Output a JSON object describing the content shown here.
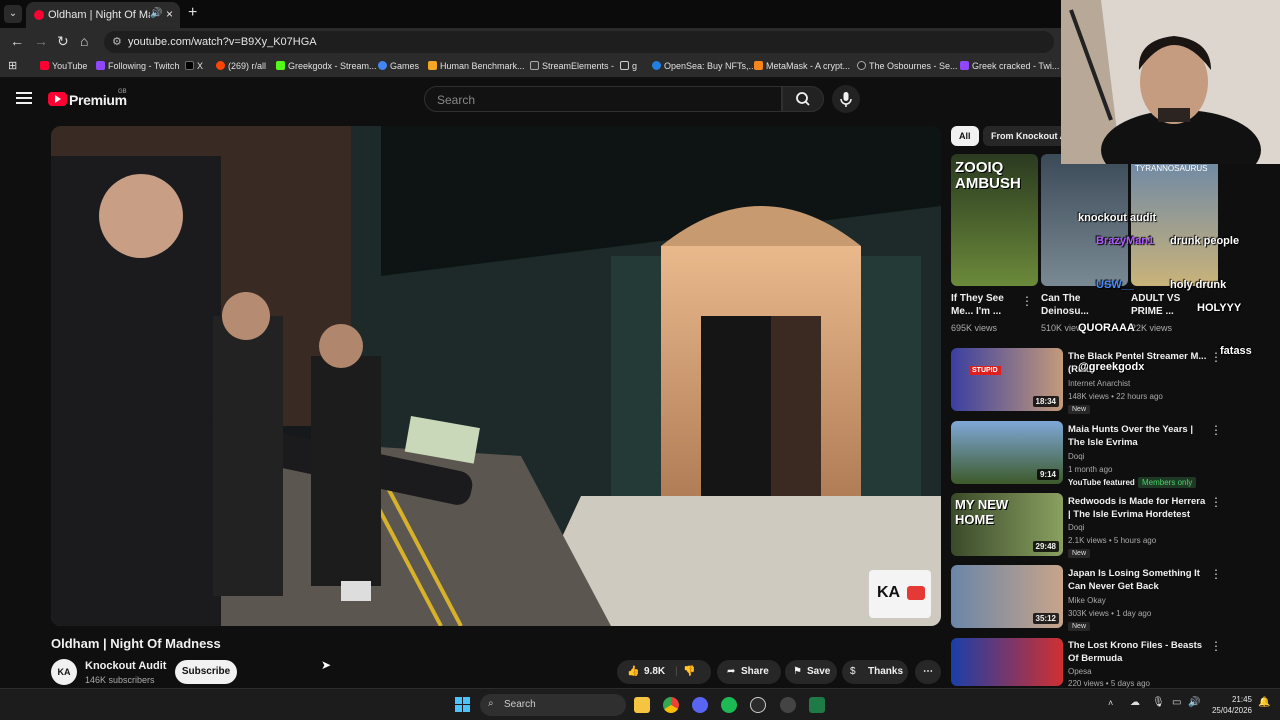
{
  "browser": {
    "tab_title": "Oldham | Night Of Madness",
    "url": "youtube.com/watch?v=B9Xy_K07HGA",
    "bookmarks": [
      "YouTube",
      "Following - Twitch",
      "X",
      "(269) r/all",
      "Greekgodx - Stream...",
      "Games",
      "Human Benchmark...",
      "StreamElements -",
      "g",
      "OpenSea: Buy NFTs,...",
      "MetaMask - A crypt...",
      "The Osbournes - Se...",
      "Greek cracked - Twi..."
    ]
  },
  "header": {
    "brand": "Premium",
    "country": "GB",
    "search_placeholder": "Search"
  },
  "video": {
    "title": "Oldham | Night Of Madness",
    "watermark": "KA",
    "channel": {
      "avatar_text": "KA",
      "name": "Knockout Audit",
      "subscribers": "146K subscribers",
      "subscribe_label": "Subscribe"
    },
    "actions": {
      "likes": "9.8K",
      "share": "Share",
      "save": "Save",
      "thanks": "Thanks"
    }
  },
  "sidebar": {
    "chips": [
      "All",
      "From Knockout A"
    ],
    "shorts": [
      {
        "thumb_text": "ZOOIQ AMBUSH",
        "title": "If They See Me... I'm ...",
        "views": "695K views"
      },
      {
        "thumb_text": "",
        "title": "Can The Deinosu...",
        "views": "510K views"
      },
      {
        "thumb_text": "TYRANNOSAURUS",
        "title": "ADULT VS PRIME ...",
        "views": "22K views"
      }
    ],
    "videos": [
      {
        "title": "The Black Pentel Streamer M... (Real)",
        "channel": "Internet Anarchist",
        "meta": "148K views • 22 hours ago",
        "duration": "18:34",
        "badge": "New",
        "thumb_text": "STUPID"
      },
      {
        "title": "Maia Hunts Over the Years | The Isle Evrima",
        "channel": "Doqi",
        "meta": "1 month ago",
        "duration": "9:14",
        "badge": "",
        "featured": "YouTube featured",
        "members": "Members only"
      },
      {
        "title": "Redwoods is Made for Herrera | The Isle Evrima Hordetest",
        "channel": "Doqi",
        "meta": "2.1K views • 5 hours ago",
        "duration": "29:48",
        "badge": "New",
        "thumb_text": "MY NEW HOME"
      },
      {
        "title": "Japan Is Losing Something It Can Never Get Back",
        "channel": "Mike Okay",
        "meta": "303K views • 1 day ago",
        "duration": "35:12",
        "badge": "New"
      },
      {
        "title": "The Lost Krono Files - Beasts Of Bermuda",
        "channel": "Opesa",
        "meta": "220 views • 5 days ago",
        "duration": "",
        "badge": ""
      }
    ]
  },
  "chat_overlay": [
    "knockout audit",
    "BrazyMan1",
    "drunk people",
    "USW__",
    "holy drunk",
    "QUORAAA",
    "HOLYYY",
    "fatass",
    "@greekgodx"
  ],
  "taskbar": {
    "search": "Search",
    "time": "21:45",
    "date": "25/04/2026"
  }
}
